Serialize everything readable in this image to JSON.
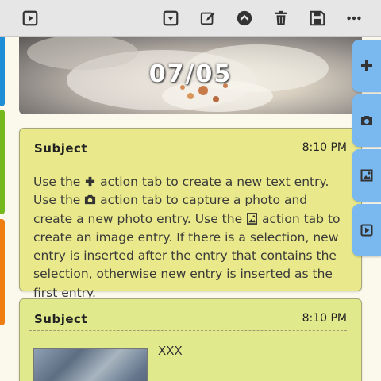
{
  "toolbar": {
    "buttons": [
      "play-icon",
      "dropdown-icon",
      "edit-icon",
      "up-icon",
      "delete-icon",
      "save-icon",
      "more-icon"
    ]
  },
  "banner": {
    "date": "07/05"
  },
  "side_tabs": [
    "add-icon",
    "camera-icon",
    "image-icon",
    "play-icon"
  ],
  "colors": {
    "left_tabs": [
      "#1e8fd6",
      "#74b81e",
      "#f07d10"
    ],
    "action_tab": "#7ab8f0",
    "card1": "#e9e88a",
    "card2": "#e0ea8c"
  },
  "entries": [
    {
      "subject": "Subject",
      "time": "8:10 PM",
      "text": {
        "p1": "Use the ",
        "p2": " action tab to create a new text entry. Use the ",
        "p3": " action tab to capture a photo and create a new photo entry. Use the ",
        "p4": " action tab to create an image entry. If there is a selection, new entry is inserted after the entry that contains the selection, otherwise new entry is inserted as the first entry."
      }
    },
    {
      "subject": "Subject",
      "time": "8:10 PM",
      "caption": "XXX"
    }
  ]
}
